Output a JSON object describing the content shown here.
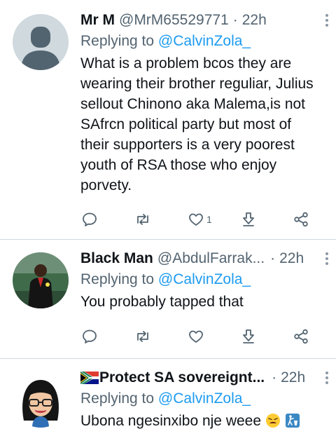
{
  "tweets": [
    {
      "name": "Mr M",
      "handle": "@MrM65529771",
      "dot": "·",
      "time": "22h",
      "replying_prefix": "Replying to",
      "replying_to": "@CalvinZola_",
      "text": "What is a problem bcos they are wearing their brother reguliar, Julius sellout Chinono aka Malema,is not SAfrcn political party but most of their supporters is a very poorest youth of RSA those who enjoy porvety.",
      "like_count": "1"
    },
    {
      "name": "Black Man",
      "handle": "@AbdulFarrak...",
      "dot": "·",
      "time": "22h",
      "replying_prefix": "Replying to",
      "replying_to": "@CalvinZola_",
      "text": "You probably tapped that",
      "like_count": ""
    },
    {
      "name": "Protect SA sovereignt...",
      "flag": "south-africa-flag-emoji",
      "handle": "",
      "dot": "·",
      "time": "22h",
      "replying_prefix": "Replying to",
      "replying_to": "@CalvinZola_",
      "text": "Ubona ngesinxibo nje weee",
      "emojis": [
        "tired-face-emoji",
        "litter-in-bin-emoji"
      ]
    }
  ],
  "icons": {
    "reply": "reply-icon",
    "retweet": "retweet-icon",
    "like": "heart-icon",
    "download": "download-icon",
    "share": "share-icon",
    "more": "more-vertical-icon"
  },
  "colors": {
    "text": "#0f1419",
    "secondary": "#536471",
    "mention": "#1d9bf0",
    "divider": "#cfd9de"
  }
}
